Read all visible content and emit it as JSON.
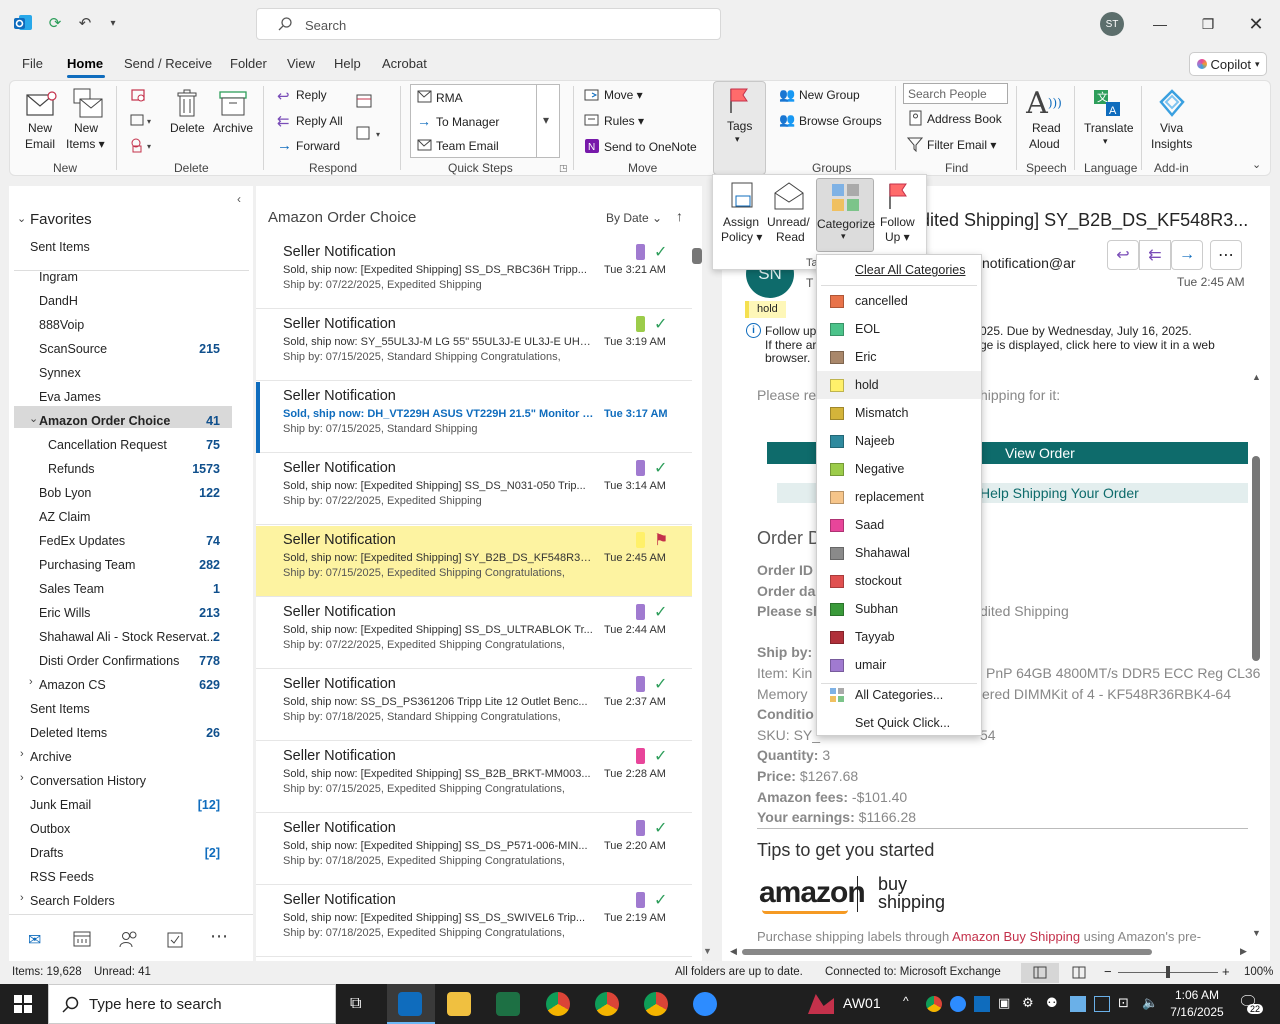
{
  "titlebar": {
    "search_placeholder": "Search",
    "avatar_initials": "ST"
  },
  "menu": {
    "file": "File",
    "home": "Home",
    "send_receive": "Send / Receive",
    "folder": "Folder",
    "view": "View",
    "help": "Help",
    "acrobat": "Acrobat",
    "copilot": "Copilot"
  },
  "ribbon": {
    "new_email": [
      "New",
      "Email"
    ],
    "new_items": [
      "New",
      "Items"
    ],
    "delete": "Delete",
    "archive": "Archive",
    "reply": "Reply",
    "reply_all": "Reply All",
    "forward": "Forward",
    "qs_rma": "RMA",
    "qs_manager": "To Manager",
    "qs_team": "Team Email",
    "move": "Move",
    "rules": "Rules",
    "onenote": "Send to OneNote",
    "tags": "Tags",
    "new_group": "New Group",
    "browse_groups": "Browse Groups",
    "search_people": "Search People",
    "address_book": "Address Book",
    "filter_email": "Filter Email",
    "read_aloud": [
      "Read",
      "Aloud"
    ],
    "translate": "Translate",
    "viva": [
      "Viva",
      "Insights"
    ],
    "groups": {
      "new": "New",
      "delete": "Delete",
      "respond": "Respond",
      "quick_steps": "Quick Steps",
      "move": "Move",
      "groups": "Groups",
      "find": "Find",
      "speech": "Speech",
      "language": "Language",
      "addin": "Add-in"
    }
  },
  "tags_panel": {
    "assign": [
      "Assign",
      "Policy"
    ],
    "unread": [
      "Unread/",
      "Read"
    ],
    "categorize": "Categorize",
    "follow": [
      "Follow",
      "Up"
    ]
  },
  "category_menu": {
    "clear": "Clear All Categories",
    "items": [
      {
        "name": "cancelled",
        "color": "#e8734a"
      },
      {
        "name": "EOL",
        "color": "#4cc38a"
      },
      {
        "name": "Eric",
        "color": "#a9876a"
      },
      {
        "name": "hold",
        "color": "#fff06a"
      },
      {
        "name": "Mismatch",
        "color": "#d4b43a"
      },
      {
        "name": "Najeeb",
        "color": "#2f8a9e"
      },
      {
        "name": "Negative",
        "color": "#9ccc4a"
      },
      {
        "name": "replacement",
        "color": "#f6c58a"
      },
      {
        "name": "Saad",
        "color": "#e8459a"
      },
      {
        "name": "Shahawal",
        "color": "#8a8a8a"
      },
      {
        "name": "stockout",
        "color": "#e05050"
      },
      {
        "name": "Subhan",
        "color": "#3a9a3a"
      },
      {
        "name": "Tayyab",
        "color": "#b0303a"
      },
      {
        "name": "umair",
        "color": "#a07ad0"
      }
    ],
    "all": "All Categories...",
    "quick_click": "Set Quick Click..."
  },
  "nav": {
    "favorites": "Favorites",
    "sent_fav": "Sent Items",
    "folders": [
      {
        "name": "Ingram",
        "count": ""
      },
      {
        "name": "DandH",
        "count": ""
      },
      {
        "name": "888Voip",
        "count": ""
      },
      {
        "name": "ScanSource",
        "count": "215"
      },
      {
        "name": "Synnex",
        "count": ""
      },
      {
        "name": "Eva James",
        "count": ""
      },
      {
        "name": "Amazon Order Choice",
        "count": "41"
      },
      {
        "name": "Cancellation Request",
        "count": "75"
      },
      {
        "name": "Refunds",
        "count": "1573"
      },
      {
        "name": "Bob Lyon",
        "count": "122"
      },
      {
        "name": "AZ Claim",
        "count": ""
      },
      {
        "name": "FedEx Updates",
        "count": "74"
      },
      {
        "name": "Purchasing Team",
        "count": "282"
      },
      {
        "name": "Sales Team",
        "count": "1"
      },
      {
        "name": "Eric Wills",
        "count": "213"
      },
      {
        "name": "Shahawal Ali - Stock Reservat...",
        "count": "2"
      },
      {
        "name": "Disti Order Confirmations",
        "count": "778"
      },
      {
        "name": "Amazon CS",
        "count": "629"
      },
      {
        "name": "Sent Items",
        "count": ""
      },
      {
        "name": "Deleted Items",
        "count": "26"
      },
      {
        "name": "Archive",
        "count": ""
      },
      {
        "name": "Conversation History",
        "count": ""
      },
      {
        "name": "Junk Email",
        "count": "[12]"
      },
      {
        "name": "Outbox",
        "count": ""
      },
      {
        "name": "Drafts",
        "count": "[2]"
      },
      {
        "name": "RSS Feeds",
        "count": ""
      },
      {
        "name": "Search Folders",
        "count": ""
      }
    ]
  },
  "list": {
    "folder_title": "Amazon Order Choice",
    "sort": "By Date",
    "messages": [
      {
        "from": "Seller Notification",
        "subject": "Sold, ship now: [Expedited Shipping] SS_DS_RBC36H Tripp...",
        "preview": "Ship by: 07/22/2025, Expedited Shipping",
        "time": "Tue 3:21 AM",
        "cat": "#a07ad0"
      },
      {
        "from": "Seller Notification",
        "subject": "Sold, ship now: SY_55UL3J-M LG 55\" 55UL3J-E UL3J-E UHD ...",
        "preview": "Ship by: 07/15/2025, Standard Shipping  Congratulations,",
        "time": "Tue 3:19 AM",
        "cat": "#9ccc4a"
      },
      {
        "from": "Seller Notification",
        "subject": "Sold, ship now: DH_VT229H ASUS VT229H 21.5\" Monitor 1...",
        "preview": "Ship by: 07/15/2025, Standard Shipping",
        "time": "Tue 3:17 AM",
        "cat": ""
      },
      {
        "from": "Seller Notification",
        "subject": "Sold, ship now: [Expedited Shipping] SS_DS_N031-050 Trip...",
        "preview": "Ship by: 07/22/2025, Expedited Shipping",
        "time": "Tue 3:14 AM",
        "cat": "#a07ad0"
      },
      {
        "from": "Seller Notification",
        "subject": "Sold, ship now: [Expedited Shipping] SY_B2B_DS_KF548R36...",
        "preview": "Ship by: 07/15/2025, Expedited Shipping  Congratulations,",
        "time": "Tue 2:45 AM",
        "cat": "#fff06a"
      },
      {
        "from": "Seller Notification",
        "subject": "Sold, ship now: [Expedited Shipping] SS_DS_ULTRABLOK Tr...",
        "preview": "Ship by: 07/22/2025, Expedited Shipping  Congratulations,",
        "time": "Tue 2:44 AM",
        "cat": "#a07ad0"
      },
      {
        "from": "Seller Notification",
        "subject": "Sold, ship now: SS_DS_PS361206 Tripp Lite 12 Outlet Benc...",
        "preview": "Ship by: 07/18/2025, Standard Shipping  Congratulations,",
        "time": "Tue 2:37 AM",
        "cat": "#a07ad0"
      },
      {
        "from": "Seller Notification",
        "subject": "Sold, ship now: [Expedited Shipping] SS_B2B_BRKT-MM003...",
        "preview": "Ship by: 07/15/2025, Expedited Shipping  Congratulations,",
        "time": "Tue 2:28 AM",
        "cat": "#e8459a"
      },
      {
        "from": "Seller Notification",
        "subject": "Sold, ship now: [Expedited Shipping] SS_DS_P571-006-MIN...",
        "preview": "Ship by: 07/18/2025, Expedited Shipping  Congratulations,",
        "time": "Tue 2:20 AM",
        "cat": "#a07ad0"
      },
      {
        "from": "Seller Notification",
        "subject": "Sold, ship now: [Expedited Shipping] SS_DS_SWIVEL6 Trip...",
        "preview": "Ship by: 07/18/2025, Expedited Shipping  Congratulations,",
        "time": "Tue 2:19 AM",
        "cat": "#a07ad0"
      }
    ]
  },
  "reading": {
    "subject": "dited Shipping] SY_B2B_DS_KF548R3...",
    "sender_initials": "SN",
    "from_addr": "notification@ar",
    "to_prefix": "T",
    "time": "Tue 2:45 AM",
    "tag": "hold",
    "followup_1": "Follow up",
    "followup_2": "025.  Due by Wednesday, July 16, 2025.",
    "info_1": "If there ar",
    "info_2": "ge is displayed, click here to view it in a web",
    "info_3": "browser.",
    "please_1": "Please re",
    "please_2": "hipping for it:",
    "view_order": "View Order",
    "help_ship": "Help Shipping Your Order",
    "order_heading": "Order D",
    "order_id": "Order ID",
    "order_date": "Order da",
    "please_sh": "Please sh",
    "exp_ship": "dited Shipping",
    "ship_by": "Ship by:",
    "item": "Item: Kin",
    "item_2": "PnP 64GB 4800MT/s DDR5 ECC Reg CL36",
    "memory": "Memory",
    "memory_2": "ered DIMMKit of 4 - KF548R36RBK4-64",
    "condition": "Conditio",
    "sku": "SKU: SY_",
    "sku_2": "54",
    "quantity_label": "Quantity:",
    "quantity": "3",
    "price_label": "Price:",
    "price": "$1267.68",
    "fees_label": "Amazon fees:",
    "fees": "-$101.40",
    "earnings_label": "Your earnings:",
    "earnings": "$1166.28",
    "tips": "Tips to get you started",
    "amazon": "amazon",
    "buy": "buy",
    "shipping": "shipping",
    "purchase_1": "Purchase shipping labels through ",
    "purchase_link": "Amazon Buy Shipping",
    "purchase_2": " using Amazon's pre-"
  },
  "status": {
    "items": "Items: 19,628",
    "unread": "Unread: 41",
    "uptodate": "All folders are up to date.",
    "connected": "Connected to: Microsoft Exchange",
    "zoom": "100%"
  },
  "taskbar": {
    "search": "Type here to search",
    "aw": "AW01",
    "time": "1:06 AM",
    "date": "7/16/2025",
    "notif": "22"
  }
}
